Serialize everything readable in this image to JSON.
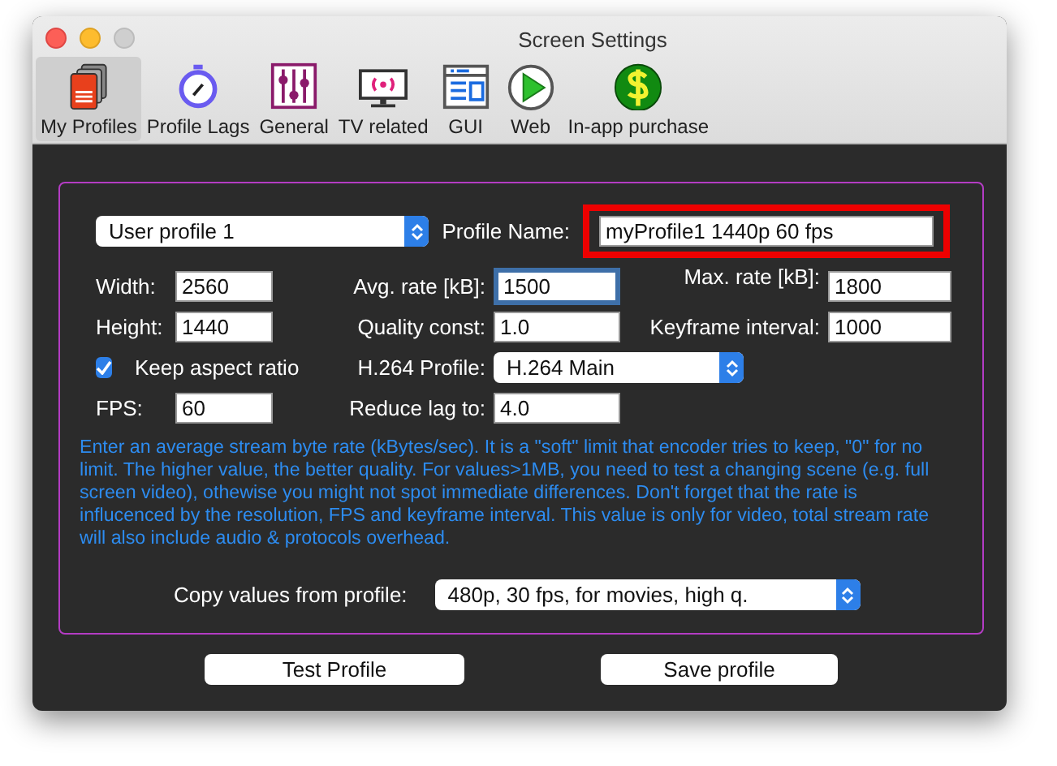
{
  "window": {
    "title": "Screen Settings"
  },
  "toolbar": {
    "items": [
      {
        "label": "My Profiles",
        "selected": true
      },
      {
        "label": "Profile Lags",
        "selected": false
      },
      {
        "label": "General",
        "selected": false
      },
      {
        "label": "TV related",
        "selected": false
      },
      {
        "label": "GUI",
        "selected": false
      },
      {
        "label": "Web",
        "selected": false
      },
      {
        "label": "In-app purchase",
        "selected": false
      }
    ]
  },
  "profile_select": {
    "value": "User profile 1"
  },
  "profile_name": {
    "label": "Profile Name:",
    "value": "myProfile1 1440p 60 fps",
    "highlighted": true
  },
  "rows": [
    [
      {
        "kind": "text",
        "label": "Width:",
        "value": "2560",
        "focused": false
      },
      {
        "kind": "text",
        "label": "Avg. rate [kB]:",
        "value": "1500",
        "focused": true
      },
      {
        "kind": "text",
        "label": "Max. rate [kB]:",
        "value": "1800",
        "focused": false
      }
    ],
    [
      {
        "kind": "text",
        "label": "Height:",
        "value": "1440",
        "focused": false
      },
      {
        "kind": "text",
        "label": "Quality const:",
        "value": "1.0",
        "focused": false
      },
      {
        "kind": "text",
        "label": "Keyframe interval:",
        "value": "1000",
        "focused": false
      }
    ],
    [
      {
        "kind": "checkbox",
        "label": "Keep aspect ratio",
        "checked": true
      },
      {
        "kind": "select",
        "label": "H.264 Profile:",
        "value": "H.264 Main"
      }
    ],
    [
      {
        "kind": "text",
        "label": "FPS:",
        "value": "60",
        "focused": false
      },
      {
        "kind": "text",
        "label": "Reduce lag to:",
        "value": "4.0",
        "focused": false
      }
    ]
  ],
  "help_text": "Enter an average stream byte rate (kBytes/sec). It is a \"soft\" limit that encoder tries to keep, \"0\" for no limit. The higher value, the better quality. For values>1MB, you need to test a changing scene (e.g. full screen video), othewise you might not spot immediate differences. Don't forget that the rate is influcenced by the resolution, FPS and keyframe interval. This value is only for video, total stream rate will also include audio & protocols overhead.",
  "copy_from": {
    "label": "Copy values from profile:",
    "value": "480p, 30 fps, for movies, high q."
  },
  "buttons": [
    "Test Profile",
    "Save profile"
  ]
}
